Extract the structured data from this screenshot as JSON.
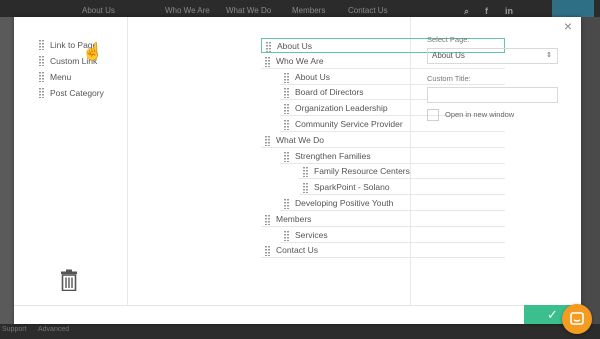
{
  "background": {
    "nav_items": [
      "Who We Are",
      "What We Do",
      "Members",
      "Contact Us"
    ],
    "nav_partial_left": "About Us",
    "social_icons": [
      "search-icon",
      "facebook-icon",
      "linkedin-icon"
    ],
    "bottom_left_text": "Support",
    "bottom_right_text": "Advanced"
  },
  "modal": {
    "close_icon": "close-icon",
    "item_types": [
      {
        "label": "Link to Page"
      },
      {
        "label": "Custom Link"
      },
      {
        "label": "Menu"
      },
      {
        "label": "Post Category"
      }
    ],
    "trash_icon": "trash-icon",
    "menu_items": [
      {
        "label": "About Us",
        "depth": 0,
        "active": true
      },
      {
        "label": "Who We Are",
        "depth": 0
      },
      {
        "label": "About Us",
        "depth": 1
      },
      {
        "label": "Board of Directors",
        "depth": 1
      },
      {
        "label": "Organization Leadership",
        "depth": 1
      },
      {
        "label": "Community Service Provider",
        "depth": 1
      },
      {
        "label": "What We Do",
        "depth": 0
      },
      {
        "label": "Strengthen Families",
        "depth": 1
      },
      {
        "label": "Family Resource Centers",
        "depth": 2
      },
      {
        "label": "SparkPoint - Solano",
        "depth": 2
      },
      {
        "label": "Developing Positive Youth",
        "depth": 1
      },
      {
        "label": "Members",
        "depth": 0
      },
      {
        "label": "Services",
        "depth": 1
      },
      {
        "label": "Contact Us",
        "depth": 0
      }
    ],
    "settings": {
      "select_page_label": "Select Page:",
      "select_page_value": "About Us",
      "custom_title_label": "Custom Title:",
      "custom_title_value": "",
      "open_new_window_label": "Open in new window",
      "open_new_window_checked": false
    },
    "confirm_icon": "checkmark-icon"
  },
  "chat_widget_icon": "chat-icon",
  "colors": {
    "accent": "#3bbf8e",
    "active_border": "#63c7a0",
    "chat": "#f49c22"
  }
}
